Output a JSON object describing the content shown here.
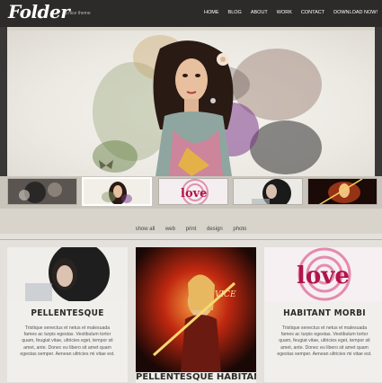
{
  "site": {
    "logo": "Folder",
    "tagline": "a nice theme"
  },
  "nav": {
    "items": [
      "HOME",
      "BLOG",
      "ABOUT",
      "WORK",
      "CONTACT",
      "DOWNLOAD NOW!"
    ]
  },
  "filters": {
    "items": [
      "show all",
      "web",
      "print",
      "design",
      "photo"
    ]
  },
  "thumbnails": {
    "count": 5,
    "active_index": 1
  },
  "cards": [
    {
      "title": "PELLENTESQUE",
      "text": "Tristique senectus et netus et malesuada fames ac turpis egestas. Vestibulum tortor quam, feugiat vitae, ultricies eget, tempor sit amet, ante. Donec eu libero sit amet quam egestas semper. Aenean ultricies mi vitae est."
    },
    {
      "title": "PELLENTESQUE HABITANT",
      "text": ""
    },
    {
      "title": "HABITANT MORBI",
      "text": "Tristique senectus et netus et malesuada fames ac turpis egestas. Vestibulum tortor quam, feugiat vitae, ultricies eget, tempor sit amet, ante. Donec eu libero sit amet quam egestas semper. Aenean ultricies mi vitae est."
    }
  ],
  "colors": {
    "header_bg": "#2c2b29",
    "page_bg": "#e4e1dc",
    "card_bg": "#f1efeb",
    "accent_pink": "#c2185b"
  }
}
